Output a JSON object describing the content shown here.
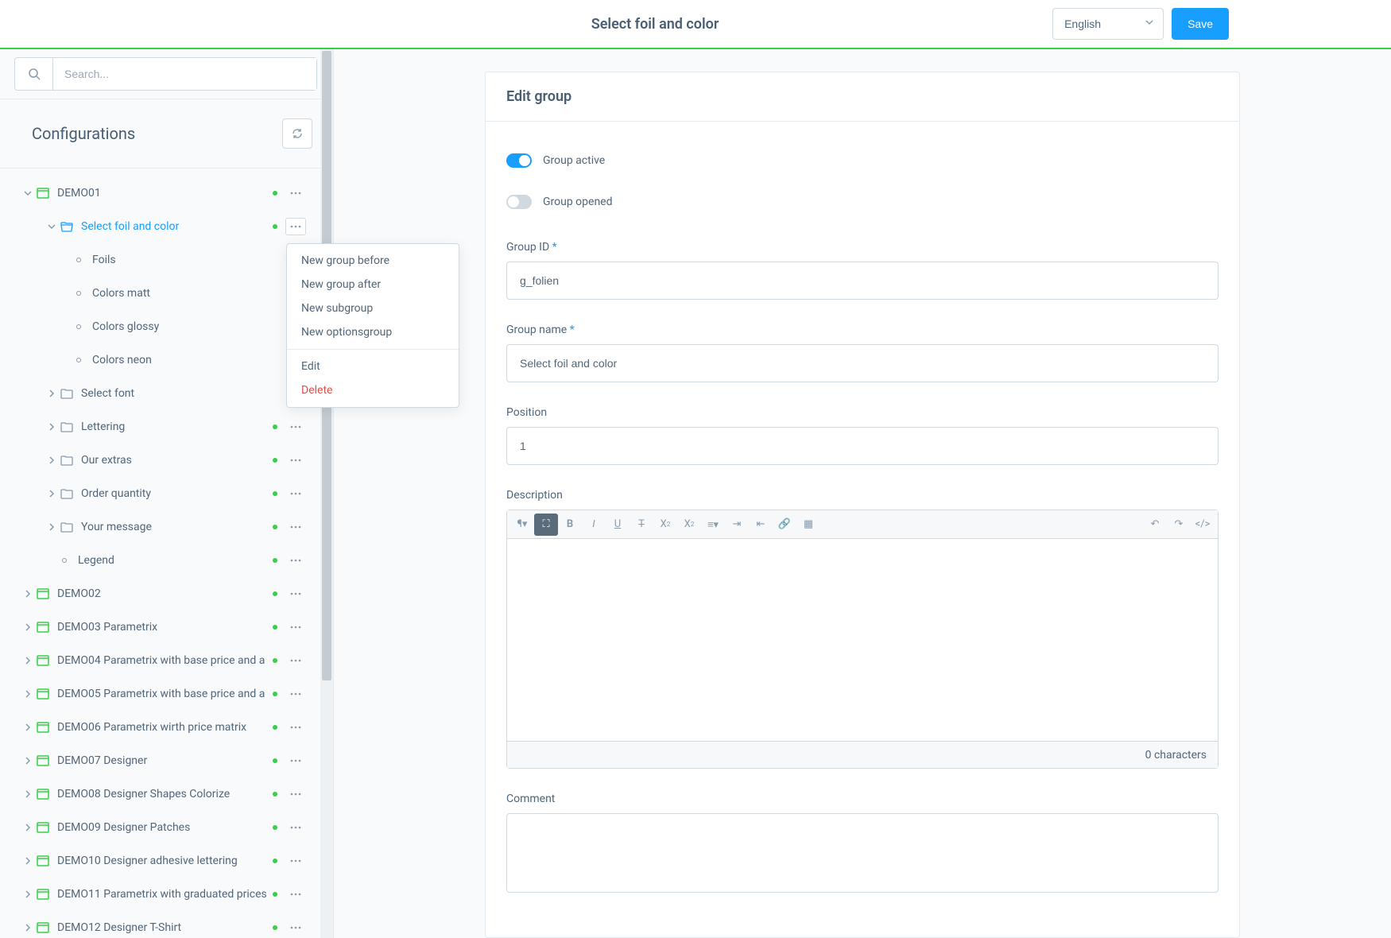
{
  "topbar": {
    "title": "Select foil and color",
    "language": "English",
    "save": "Save"
  },
  "sidebar": {
    "search_placeholder": "Search...",
    "configurations_title": "Configurations"
  },
  "tree": {
    "demo01": "DEMO01",
    "select_foil": "Select foil and color",
    "foils": "Foils",
    "colors_matt": "Colors matt",
    "colors_glossy": "Colors glossy",
    "colors_neon": "Colors neon",
    "select_font": "Select font",
    "lettering": "Lettering",
    "our_extras": "Our extras",
    "order_quantity": "Order quantity",
    "your_message": "Your message",
    "legend": "Legend",
    "demo02": "DEMO02",
    "demo03": "DEMO03 Parametrix",
    "demo04": "DEMO04 Parametrix with base price and a",
    "demo05": "DEMO05 Parametrix with base price and a",
    "demo06": "DEMO06 Parametrix wirth price matrix",
    "demo07": "DEMO07 Designer",
    "demo08": "DEMO08 Designer Shapes Colorize",
    "demo09": "DEMO09 Designer Patches",
    "demo10": "DEMO10 Designer adhesive lettering",
    "demo11": "DEMO11 Parametrix with graduated prices",
    "demo12": "DEMO12 Designer T-Shirt"
  },
  "context_menu": {
    "new_before": "New group before",
    "new_after": "New group after",
    "new_sub": "New subgroup",
    "new_options": "New optionsgroup",
    "edit": "Edit",
    "delete": "Delete"
  },
  "panel": {
    "title": "Edit group",
    "group_active_label": "Group active",
    "group_active": true,
    "group_opened_label": "Group opened",
    "group_opened": false,
    "group_id_label": "Group ID",
    "group_id_value": "g_folien",
    "group_name_label": "Group name",
    "group_name_value": "Select foil and color",
    "position_label": "Position",
    "position_value": "1",
    "description_label": "Description",
    "char_count": "0 characters",
    "comment_label": "Comment"
  }
}
